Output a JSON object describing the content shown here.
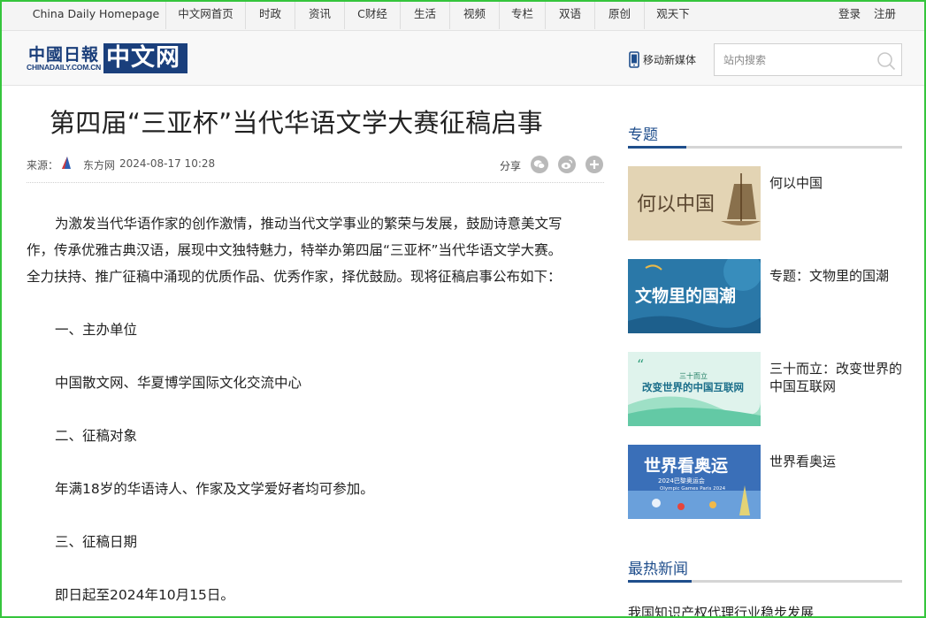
{
  "topnav": {
    "items": [
      "China Daily Homepage",
      "中文网首页",
      "时政",
      "资讯",
      "C财经",
      "生活",
      "视频",
      "专栏",
      "双语",
      "原创",
      "观天下"
    ],
    "login": "登录",
    "register": "注册"
  },
  "header": {
    "logo_cd": "中國日報",
    "logo_url": "CHINADAILY.COM.CN",
    "logo_zw": "中文网",
    "mobile": "移动新媒体",
    "search_placeholder": "站内搜索"
  },
  "article": {
    "title": "第四届“三亚杯”当代华语文学大赛征稿启事",
    "source_label": "来源：",
    "source_name": "东方网",
    "datetime": "2024-08-17 10:28",
    "share_label": "分享",
    "paragraphs": [
      "为激发当代华语作家的创作激情，推动当代文学事业的繁荣与发展，鼓励诗意美文写",
      "作，传承优雅古典汉语，展现中文独特魅力，特举办第四届“三亚杯”当代华语文学大赛。",
      "全力扶持、推广征稿中涌现的优质作品、优秀作家，择优鼓励。现将征稿启事公布如下：",
      "一、主办单位",
      "中国散文网、华夏博学国际文化交流中心",
      "二、征稿对象",
      "年满18岁的华语诗人、作家及文学爱好者均可参加。",
      "三、征稿日期",
      "即日起至2024年10月15日。"
    ]
  },
  "sidebar": {
    "topics_heading": "专题",
    "topics": [
      {
        "title": "何以中国",
        "thumb_text": "何以中国"
      },
      {
        "title": "专题：文物里的国潮",
        "thumb_text": "文物里的国潮"
      },
      {
        "title": "三十而立：改变世界的中国互联网",
        "thumb_text": "改变世界的中国互联网",
        "thumb_small": "三十而立"
      },
      {
        "title": "世界看奥运",
        "thumb_text": "世界看奥运",
        "thumb_small": "2024巴黎奥运会",
        "thumb_small2": "Olympic Games Paris 2024"
      }
    ],
    "news_heading": "最热新闻",
    "news": [
      "我国知识产权代理行业稳步发展"
    ]
  },
  "colors": {
    "accent": "#1f4e8c",
    "frame": "#35c53c"
  }
}
